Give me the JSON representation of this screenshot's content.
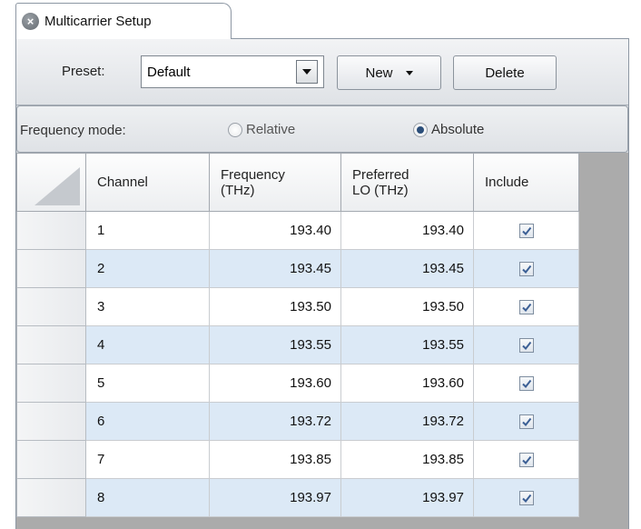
{
  "tab": {
    "title": "Multicarrier Setup",
    "close_icon": "close-circle-icon"
  },
  "preset": {
    "label": "Preset:",
    "selected": "Default",
    "new_label": "New",
    "delete_label": "Delete"
  },
  "frequency_mode": {
    "label": "Frequency mode:",
    "options": [
      "Relative",
      "Absolute"
    ],
    "selected": "Absolute"
  },
  "grid": {
    "columns": [
      "Channel",
      "Frequency\n(THz)",
      "Preferred\nLO (THz)",
      "Include"
    ],
    "rows": [
      {
        "channel": "1",
        "frequency": "193.40",
        "lo": "193.40",
        "include": true
      },
      {
        "channel": "2",
        "frequency": "193.45",
        "lo": "193.45",
        "include": true
      },
      {
        "channel": "3",
        "frequency": "193.50",
        "lo": "193.50",
        "include": true
      },
      {
        "channel": "4",
        "frequency": "193.55",
        "lo": "193.55",
        "include": true
      },
      {
        "channel": "5",
        "frequency": "193.60",
        "lo": "193.60",
        "include": true
      },
      {
        "channel": "6",
        "frequency": "193.72",
        "lo": "193.72",
        "include": true
      },
      {
        "channel": "7",
        "frequency": "193.85",
        "lo": "193.85",
        "include": true
      },
      {
        "channel": "8",
        "frequency": "193.97",
        "lo": "193.97",
        "include": true
      }
    ]
  },
  "colors": {
    "alt_row": "#dce9f6",
    "grid_bg": "#ababab",
    "radio_dot": "#2b4e7a"
  }
}
